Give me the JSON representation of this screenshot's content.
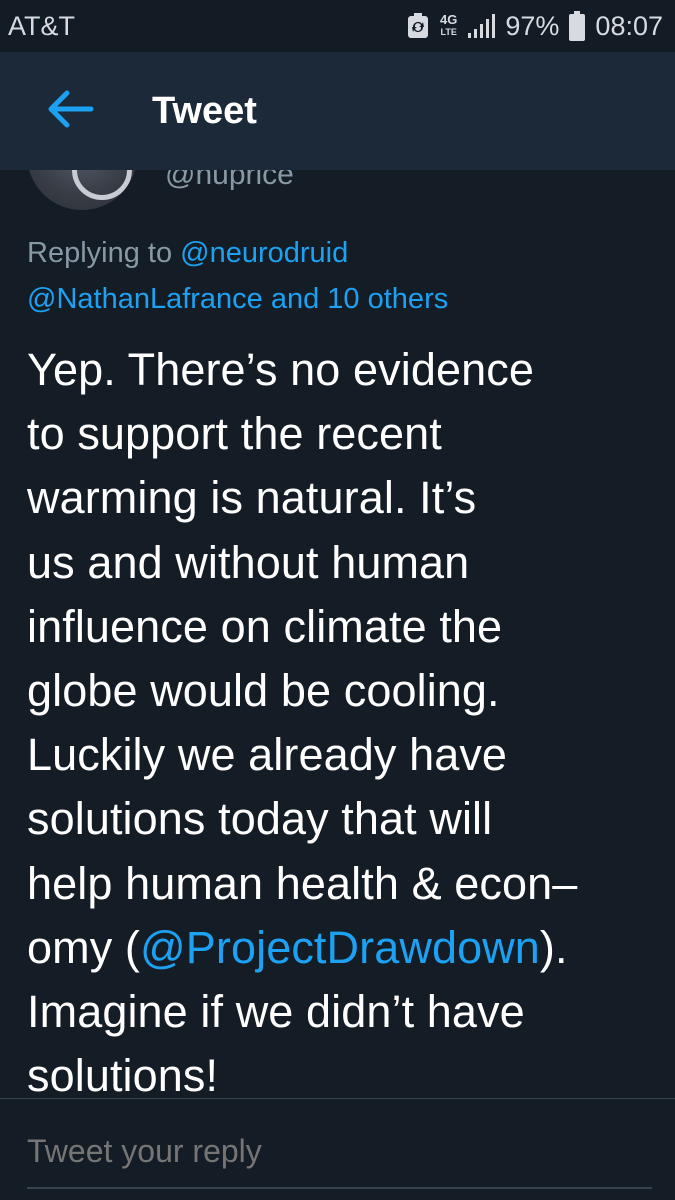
{
  "status_bar": {
    "carrier": "AT&T",
    "network_top": "4G",
    "network_bottom": "LTE",
    "battery_percent": "97%",
    "time": "08:07"
  },
  "app_bar": {
    "title": "Tweet"
  },
  "author": {
    "handle": "@nuprice"
  },
  "reply_context": {
    "prefix": "Replying to ",
    "mention_1": "@neurodruid",
    "mention_2_and_others": "@NathanLafrance and 10 others"
  },
  "tweet": {
    "lines": [
      "Yep. There’s no evidence",
      "to support the recent",
      "warming is natural. It’s",
      "us and without human",
      "influence on climate the",
      "globe would be cooling.",
      "Luckily we already have",
      "solutions today that will",
      "help human health & econ–"
    ],
    "line10_before": "omy (",
    "line10_mention": "@ProjectDrawdown",
    "line10_after": ").",
    "line11": "Imagine if we didn’t have",
    "line12": "solutions!"
  },
  "reply_box": {
    "placeholder": "Tweet your reply"
  },
  "colors": {
    "background": "#141d26",
    "app_bar": "#1c2938",
    "accent": "#1da1f2",
    "muted_text": "#8899a6"
  },
  "icons": {
    "back": "arrow-left-icon",
    "sync": "sync-notification-icon",
    "signal": "signal-bars-icon",
    "battery": "battery-icon"
  }
}
